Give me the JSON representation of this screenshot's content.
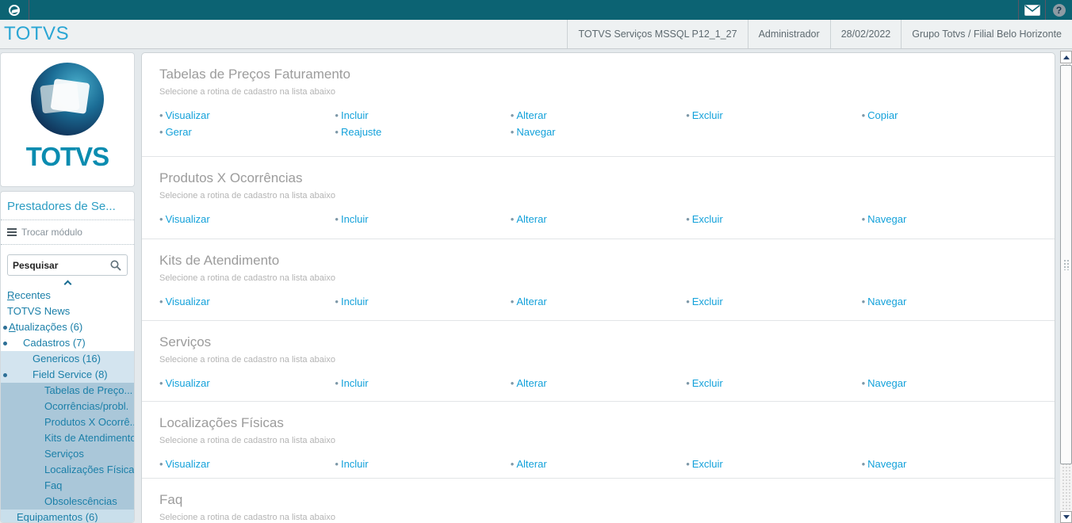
{
  "colors": {
    "topbar": "#0c6373",
    "link_blue": "#13a1da",
    "menu_teal": "#1b7fa8",
    "brand_blue": "#2ba6d4",
    "logo_teal": "#0b8cb0"
  },
  "topbar": {
    "help_glyph": "?"
  },
  "header": {
    "logo": "TOTVS",
    "environment": "TOTVS Serviços MSSQL P12_1_27",
    "user": "Administrador",
    "date": "28/02/2022",
    "company": "Grupo Totvs / Filial Belo Horizonte"
  },
  "sidebar": {
    "logo_wordmark": "TOTVS",
    "module_title": "Prestadores de Se...",
    "change_module": "Trocar módulo",
    "search_placeholder": "Pesquisar",
    "menu_items": [
      "Recentes",
      "TOTVS News",
      "Atualizações (6)",
      "Cadastros (7)",
      "Genericos (16)",
      "Field Service (8)",
      "Tabelas de Preço...",
      "Ocorrências/probl.",
      "Produtos X Ocorrê...",
      "Kits de Atendimento",
      "Serviços",
      "Localizações Físicas",
      "Faq",
      "Obsolescências",
      "Equipamentos (6)"
    ]
  },
  "main": {
    "bullet": "•",
    "sections": [
      {
        "title": "Tabelas de Preços Faturamento",
        "subtitle": "Selecione a rotina de cadastro na lista abaixo",
        "actions": [
          "Visualizar",
          "Incluir",
          "Alterar",
          "Excluir",
          "Copiar",
          "Gerar",
          "Reajuste",
          "Navegar"
        ]
      },
      {
        "title": "Produtos X Ocorrências",
        "subtitle": "Selecione a rotina de cadastro na lista abaixo",
        "actions": [
          "Visualizar",
          "Incluir",
          "Alterar",
          "Excluir",
          "Navegar"
        ]
      },
      {
        "title": "Kits de Atendimento",
        "subtitle": "Selecione a rotina de cadastro na lista abaixo",
        "actions": [
          "Visualizar",
          "Incluir",
          "Alterar",
          "Excluir",
          "Navegar"
        ]
      },
      {
        "title": "Serviços",
        "subtitle": "Selecione a rotina de cadastro na lista abaixo",
        "actions": [
          "Visualizar",
          "Incluir",
          "Alterar",
          "Excluir",
          "Navegar"
        ]
      },
      {
        "title": "Localizações Físicas",
        "subtitle": "Selecione a rotina de cadastro na lista abaixo",
        "actions": [
          "Visualizar",
          "Incluir",
          "Alterar",
          "Excluir",
          "Navegar"
        ]
      },
      {
        "title": "Faq",
        "subtitle": "Selecione a rotina de cadastro na lista abaixo",
        "actions": []
      }
    ]
  }
}
